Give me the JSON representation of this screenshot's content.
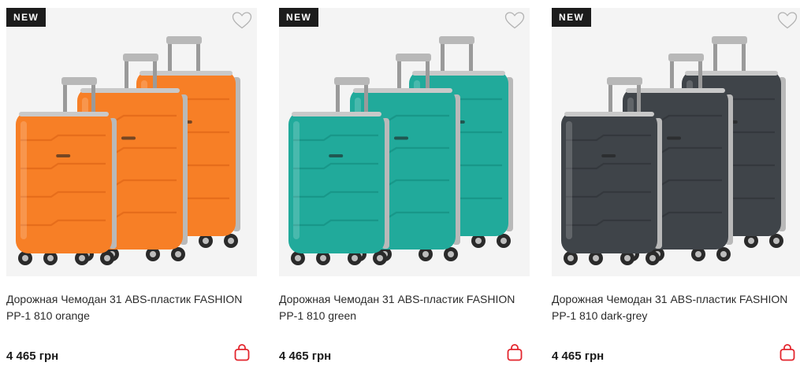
{
  "products": [
    {
      "badge": "NEW",
      "title": "Дорожная Чемодан 31 ABS-пластик FASHION PP-1 810 orange",
      "price": "4 465 грн",
      "color": "#f77f26",
      "color_dark": "#d95f12"
    },
    {
      "badge": "NEW",
      "title": "Дорожная Чемодан 31 ABS-пластик FASHION PP-1 810 green",
      "price": "4 465 грн",
      "color": "#21aa9b",
      "color_dark": "#12877a"
    },
    {
      "badge": "NEW",
      "title": "Дорожная Чемодан 31 ABS-пластик FASHION PP-1 810 dark-grey",
      "price": "4 465 грн",
      "color": "#3f4449",
      "color_dark": "#2b2f33"
    }
  ],
  "icons": {
    "favorite": "heart-outline-icon",
    "cart": "shopping-bag-icon"
  },
  "accent_color": "#e3262e"
}
